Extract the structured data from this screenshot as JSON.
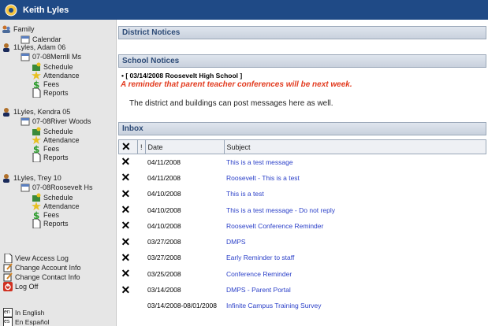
{
  "header": {
    "user_name": "Keith Lyles"
  },
  "sidebar": {
    "family": "Family",
    "calendar": "Calendar",
    "students": [
      {
        "name": "1Lyles, Adam 06",
        "school": "07-08Merrill Ms",
        "links": [
          "Schedule",
          "Attendance",
          "Fees",
          "Reports"
        ]
      },
      {
        "name": "1Lyles, Kendra 05",
        "school": "07-08River Woods",
        "links": [
          "Schedule",
          "Attendance",
          "Fees",
          "Reports"
        ]
      },
      {
        "name": "1Lyles, Trey 10",
        "school": "07-08Roosevelt Hs",
        "links": [
          "Schedule",
          "Attendance",
          "Fees",
          "Reports"
        ]
      }
    ],
    "account": [
      "View Access Log",
      "Change Account Info",
      "Change Contact Info",
      "Log Off"
    ],
    "languages": [
      {
        "code": "en",
        "label": "In English"
      },
      {
        "code": "es",
        "label": "En Español"
      }
    ]
  },
  "main": {
    "district_notices": "District Notices",
    "school_notices": "School Notices",
    "notice_title": "[ 03/14/2008 Roosevelt High School ]",
    "notice_red": "A reminder that parent teacher conferences will be next week.",
    "notice_body": "The district and buildings can post messages here as well.",
    "inbox_title": "Inbox",
    "columns": {
      "delete": "✕",
      "priority": "!",
      "date": "Date",
      "subject": "Subject"
    },
    "messages": [
      {
        "date": "04/11/2008",
        "subject": "This is a test message",
        "deletable": true
      },
      {
        "date": "04/11/2008",
        "subject": "Roosevelt - This is a test",
        "deletable": true
      },
      {
        "date": "04/10/2008",
        "subject": "This is a test",
        "deletable": true
      },
      {
        "date": "04/10/2008",
        "subject": "This is a test message - Do not reply",
        "deletable": true
      },
      {
        "date": "04/10/2008",
        "subject": "Roosevelt Conference Reminder",
        "deletable": true
      },
      {
        "date": "03/27/2008",
        "subject": "DMPS",
        "deletable": true
      },
      {
        "date": "03/27/2008",
        "subject": "Early Reminder to staff",
        "deletable": true
      },
      {
        "date": "03/25/2008",
        "subject": "Conference Reminder",
        "deletable": true
      },
      {
        "date": "03/14/2008",
        "subject": "DMPS - Parent Portal",
        "deletable": true
      },
      {
        "date": "03/14/2008-08/01/2008",
        "subject": "Infinite Campus Training Survey",
        "deletable": false
      }
    ]
  },
  "colors": {
    "header": "#1f4a86",
    "notice_red": "#e23b1f",
    "link": "#2a3fc8"
  }
}
